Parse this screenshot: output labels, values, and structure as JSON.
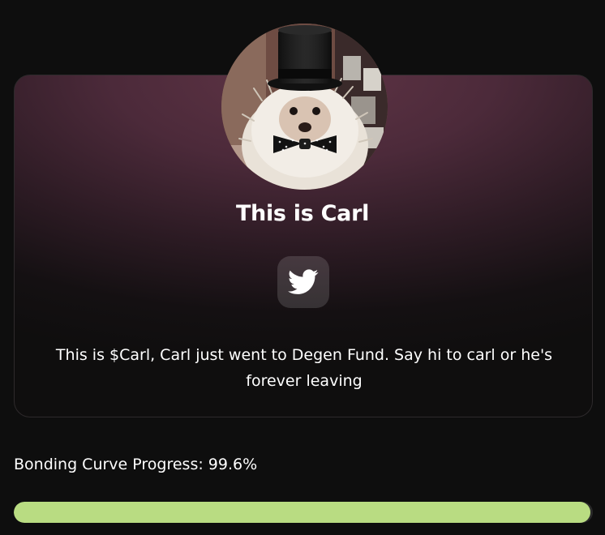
{
  "token": {
    "title": "This is Carl",
    "description": "This is $Carl, Carl just went to Degen Fund. Say hi to carl or he's forever leaving",
    "avatar_icon": "hedgehog-top-hat-photo",
    "social_icon": "twitter-bird-icon"
  },
  "progress": {
    "label": "Bonding Curve Progress: 99.6%",
    "percent": 99.6
  },
  "colors": {
    "background": "#0e0e0e",
    "card_gradient_top": "#5f3445",
    "progress_fill": "#b9dc82",
    "text": "#ffffff"
  }
}
